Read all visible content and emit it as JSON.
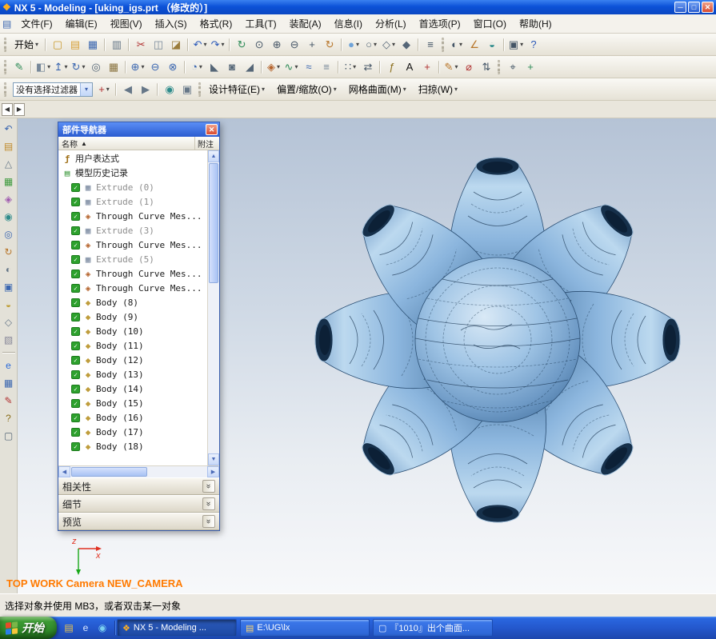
{
  "window": {
    "title": "NX 5 - Modeling - [uking_igs.prt （修改的）]"
  },
  "menubar": {
    "items": [
      "文件(F)",
      "编辑(E)",
      "视图(V)",
      "插入(S)",
      "格式(R)",
      "工具(T)",
      "装配(A)",
      "信息(I)",
      "分析(L)",
      "首选项(P)",
      "窗口(O)",
      "帮助(H)"
    ]
  },
  "toolbars": {
    "row1": [
      {
        "k": "grip"
      },
      {
        "k": "btn",
        "n": "start-app-menu-button",
        "g": "开始",
        "dd": true
      },
      {
        "k": "sep"
      },
      {
        "k": "icon",
        "n": "new-part-icon",
        "g": "▢",
        "c": "#c9992a"
      },
      {
        "k": "icon",
        "n": "open-icon",
        "g": "▤",
        "c": "#d8a23a"
      },
      {
        "k": "icon",
        "n": "save-icon",
        "g": "▦",
        "c": "#3a66b0"
      },
      {
        "k": "sep"
      },
      {
        "k": "icon",
        "n": "print-icon",
        "g": "▥",
        "c": "#667788"
      },
      {
        "k": "sep"
      },
      {
        "k": "icon",
        "n": "cut-icon",
        "g": "✂",
        "c": "#b03030"
      },
      {
        "k": "icon",
        "n": "copy-icon",
        "g": "◫",
        "c": "#778899"
      },
      {
        "k": "icon",
        "n": "paste-icon",
        "g": "◪",
        "c": "#9a7c3a"
      },
      {
        "k": "sep"
      },
      {
        "k": "icon",
        "n": "undo-icon",
        "g": "↶",
        "c": "#2a58b8",
        "dd": true
      },
      {
        "k": "icon",
        "n": "redo-icon",
        "g": "↷",
        "c": "#2a58b8",
        "dd": true
      },
      {
        "k": "sep"
      },
      {
        "k": "icon",
        "n": "refresh-icon",
        "g": "↻",
        "c": "#2e8b57"
      },
      {
        "k": "icon",
        "n": "fit-view-icon",
        "g": "⊙",
        "c": "#445566"
      },
      {
        "k": "icon",
        "n": "zoom-in-icon",
        "g": "⊕",
        "c": "#445566"
      },
      {
        "k": "icon",
        "n": "zoom-out-icon",
        "g": "⊖",
        "c": "#445566"
      },
      {
        "k": "icon",
        "n": "pan-icon",
        "g": "+",
        "c": "#445566"
      },
      {
        "k": "icon",
        "n": "rotate-view-icon",
        "g": "↻",
        "c": "#b8762a"
      },
      {
        "k": "sep"
      },
      {
        "k": "icon",
        "n": "shaded-view-icon",
        "g": "●",
        "c": "#6fa3d8",
        "dd": true
      },
      {
        "k": "icon",
        "n": "wireframe-view-icon",
        "g": "○",
        "c": "#556677",
        "dd": true
      },
      {
        "k": "icon",
        "n": "orient-view-icon",
        "g": "◇",
        "c": "#556677",
        "dd": true
      },
      {
        "k": "icon",
        "n": "perspective-icon",
        "g": "◆",
        "c": "#556677"
      },
      {
        "k": "sep"
      },
      {
        "k": "icon",
        "n": "layer-settings-icon",
        "g": "≡",
        "c": "#445566"
      },
      {
        "k": "grip"
      },
      {
        "k": "icon",
        "n": "show-hide-icon",
        "g": "◐",
        "c": "#445566",
        "dd": true
      },
      {
        "k": "icon",
        "n": "measure-icon",
        "g": "∠",
        "c": "#b8762a"
      },
      {
        "k": "icon",
        "n": "material-display-icon",
        "g": "◒",
        "c": "#2e8b8b"
      },
      {
        "k": "sep"
      },
      {
        "k": "icon",
        "n": "window-icon",
        "g": "▣",
        "c": "#445566",
        "dd": true
      },
      {
        "k": "icon",
        "n": "help-icon",
        "g": "?",
        "c": "#2a58b8"
      }
    ],
    "row2": [
      {
        "k": "grip"
      },
      {
        "k": "icon",
        "n": "sketch-icon",
        "g": "✎",
        "c": "#2e8b57"
      },
      {
        "k": "sep"
      },
      {
        "k": "icon",
        "n": "datum-plane-icon",
        "g": "◧",
        "c": "#778899",
        "dd": true
      },
      {
        "k": "icon",
        "n": "extrude-icon",
        "g": "↥",
        "c": "#3a66b0",
        "dd": true
      },
      {
        "k": "icon",
        "n": "revolve-icon",
        "g": "↻",
        "c": "#3a66b0",
        "dd": true
      },
      {
        "k": "icon",
        "n": "hole-icon",
        "g": "◎",
        "c": "#556677"
      },
      {
        "k": "icon",
        "n": "block-icon",
        "g": "▦",
        "c": "#8a7440"
      },
      {
        "k": "sep"
      },
      {
        "k": "icon",
        "n": "unite-icon",
        "g": "⊕",
        "c": "#3a66b0",
        "dd": true
      },
      {
        "k": "icon",
        "n": "subtract-icon",
        "g": "⊖",
        "c": "#3a66b0"
      },
      {
        "k": "icon",
        "n": "intersect-icon",
        "g": "⊗",
        "c": "#3a66b0"
      },
      {
        "k": "sep"
      },
      {
        "k": "icon",
        "n": "edge-blend-icon",
        "g": "◔",
        "c": "#3a66b0",
        "dd": true
      },
      {
        "k": "icon",
        "n": "chamfer-icon",
        "g": "◣",
        "c": "#556677"
      },
      {
        "k": "icon",
        "n": "shell-icon",
        "g": "◙",
        "c": "#556677"
      },
      {
        "k": "icon",
        "n": "draft-icon",
        "g": "◢",
        "c": "#556677"
      },
      {
        "k": "sep"
      },
      {
        "k": "icon",
        "n": "through-curve-mesh-icon",
        "g": "◈",
        "c": "#b4622a",
        "dd": true
      },
      {
        "k": "icon",
        "n": "swept-icon",
        "g": "∿",
        "c": "#2e8b57",
        "dd": true
      },
      {
        "k": "icon",
        "n": "ruled-surface-icon",
        "g": "≈",
        "c": "#3a66b0"
      },
      {
        "k": "icon",
        "n": "offset-surface-icon",
        "g": "≡",
        "c": "#778899"
      },
      {
        "k": "sep"
      },
      {
        "k": "icon",
        "n": "pattern-icon",
        "g": "∷",
        "c": "#445566",
        "dd": true
      },
      {
        "k": "icon",
        "n": "mirror-icon",
        "g": "⇄",
        "c": "#445566"
      },
      {
        "k": "sep"
      },
      {
        "k": "icon",
        "n": "expression-icon",
        "g": "ƒ",
        "c": "#8a6d1a"
      },
      {
        "k": "icon",
        "n": "text-icon",
        "g": "A",
        "c": "#111111"
      },
      {
        "k": "icon",
        "n": "point-icon",
        "g": "+",
        "c": "#b03030"
      },
      {
        "k": "sep"
      },
      {
        "k": "icon",
        "n": "edit-feature-icon",
        "g": "✎",
        "c": "#b8762a",
        "dd": true
      },
      {
        "k": "icon",
        "n": "suppress-feature-icon",
        "g": "⌀",
        "c": "#b03030"
      },
      {
        "k": "icon",
        "n": "move-object-icon",
        "g": "⇅",
        "c": "#445566"
      },
      {
        "k": "grip"
      },
      {
        "k": "icon",
        "n": "snap-point-icon",
        "g": "⌖",
        "c": "#445566"
      },
      {
        "k": "icon",
        "n": "wcs-icon",
        "g": "+",
        "c": "#2e8b57"
      }
    ],
    "filter_combo": "没有选择过滤器",
    "filter_icons": [
      {
        "k": "icon",
        "n": "general-selection-icon",
        "g": "+",
        "c": "#b03030",
        "dd": true
      },
      {
        "k": "sep"
      },
      {
        "k": "icon",
        "n": "previous-selection-icon",
        "g": "◀",
        "c": "#667788"
      },
      {
        "k": "icon",
        "n": "next-selection-icon",
        "g": "▶",
        "c": "#667788"
      },
      {
        "k": "sep"
      },
      {
        "k": "icon",
        "n": "snap-enable-icon",
        "g": "◉",
        "c": "#2e8b8b"
      },
      {
        "k": "icon",
        "n": "capture-icon",
        "g": "▣",
        "c": "#667788"
      },
      {
        "k": "grip"
      }
    ],
    "filter_menus": [
      {
        "n": "design-features-menu",
        "label": "设计特征(E)"
      },
      {
        "n": "offset-scale-menu",
        "label": "偏置/缩放(O)"
      },
      {
        "n": "mesh-surface-menu",
        "label": "网格曲面(M)"
      },
      {
        "n": "sweep-menu",
        "label": "扫掠(W)"
      }
    ]
  },
  "resource_bar": {
    "icons": [
      {
        "k": "icon",
        "n": "nav-back-icon",
        "g": "↶",
        "c": "#3a66b0"
      },
      {
        "k": "icon",
        "n": "assembly-navigator-icon",
        "g": "▤",
        "c": "#c08a2a"
      },
      {
        "k": "icon",
        "n": "constraint-navigator-icon",
        "g": "△",
        "c": "#667788"
      },
      {
        "k": "icon",
        "n": "part-navigator-icon",
        "g": "▦",
        "c": "#3e9a3e"
      },
      {
        "k": "icon",
        "n": "reuse-library-icon",
        "g": "◈",
        "c": "#a05bb0"
      },
      {
        "k": "icon",
        "n": "hd3d-tool-icon",
        "g": "◉",
        "c": "#2e8b8b"
      },
      {
        "k": "icon",
        "n": "web-browser-icon",
        "g": "◎",
        "c": "#3a66b0"
      },
      {
        "k": "icon",
        "n": "history-palette-icon",
        "g": "↻",
        "c": "#b8762a"
      },
      {
        "k": "icon",
        "n": "material-palette-icon",
        "g": "◐",
        "c": "#667788"
      },
      {
        "k": "icon",
        "n": "process-studio-icon",
        "g": "▣",
        "c": "#3a66b0"
      },
      {
        "k": "icon",
        "n": "roles-icon",
        "g": "◒",
        "c": "#c0a03a"
      },
      {
        "k": "icon",
        "n": "system-materials-icon",
        "g": "◇",
        "c": "#667788"
      },
      {
        "k": "icon",
        "n": "touch-mode-icon",
        "g": "▧",
        "c": "#889"
      },
      {
        "k": "sep"
      },
      {
        "k": "icon",
        "n": "internet-explorer-icon",
        "g": "e",
        "c": "#2a6ad8"
      },
      {
        "k": "icon",
        "n": "save-layout-icon",
        "g": "▦",
        "c": "#3a66b0"
      },
      {
        "k": "icon",
        "n": "annotate-icon",
        "g": "✎",
        "c": "#b03030"
      },
      {
        "k": "icon",
        "n": "help-icon",
        "g": "?",
        "c": "#8a6d1a"
      },
      {
        "k": "icon",
        "n": "document-icon",
        "g": "▢",
        "c": "#556677"
      }
    ]
  },
  "navigator": {
    "title": "部件导航器",
    "header": {
      "name": "名称",
      "sort": "▲",
      "note": "附注"
    },
    "tree": [
      {
        "label": "用户表达式",
        "type": "expressions",
        "ind": 0
      },
      {
        "label": "模型历史记录",
        "type": "history",
        "ind": 0
      },
      {
        "label": "Extrude (0)",
        "type": "extrude",
        "ind": 1,
        "check": true,
        "muted": true
      },
      {
        "label": "Extrude (1)",
        "type": "extrude",
        "ind": 1,
        "check": true,
        "muted": true
      },
      {
        "label": "Through Curve Mes...",
        "type": "mesh",
        "ind": 1,
        "check": true
      },
      {
        "label": "Extrude (3)",
        "type": "extrude",
        "ind": 1,
        "check": true,
        "muted": true
      },
      {
        "label": "Through Curve Mes...",
        "type": "mesh",
        "ind": 1,
        "check": true
      },
      {
        "label": "Extrude (5)",
        "type": "extrude",
        "ind": 1,
        "check": true,
        "muted": true
      },
      {
        "label": "Through Curve Mes...",
        "type": "mesh",
        "ind": 1,
        "check": true
      },
      {
        "label": "Through Curve Mes...",
        "type": "mesh",
        "ind": 1,
        "check": true
      },
      {
        "label": "Body (8)",
        "type": "body",
        "ind": 1,
        "check": true
      },
      {
        "label": "Body (9)",
        "type": "body",
        "ind": 1,
        "check": true
      },
      {
        "label": "Body (10)",
        "type": "body",
        "ind": 1,
        "check": true
      },
      {
        "label": "Body (11)",
        "type": "body",
        "ind": 1,
        "check": true
      },
      {
        "label": "Body (12)",
        "type": "body",
        "ind": 1,
        "check": true
      },
      {
        "label": "Body (13)",
        "type": "body",
        "ind": 1,
        "check": true
      },
      {
        "label": "Body (14)",
        "type": "body",
        "ind": 1,
        "check": true
      },
      {
        "label": "Body (15)",
        "type": "body",
        "ind": 1,
        "check": true
      },
      {
        "label": "Body (16)",
        "type": "body",
        "ind": 1,
        "check": true
      },
      {
        "label": "Body (17)",
        "type": "body",
        "ind": 1,
        "check": true
      },
      {
        "label": "Body (18)",
        "type": "body",
        "ind": 1,
        "check": true
      }
    ],
    "sections": [
      {
        "label": "相关性"
      },
      {
        "label": "细节"
      },
      {
        "label": "预览"
      }
    ]
  },
  "viewport": {
    "annotation": "TOP WORK Camera NEW_CAMERA",
    "axis_x": "x",
    "axis_z": "z"
  },
  "statusbar": {
    "text": "选择对象并使用 MB3，或者双击某一对象"
  },
  "taskbar": {
    "start_label": "开始",
    "quick": [
      {
        "n": "quick-launch-folder-icon",
        "g": "▤",
        "c": "#f0c84a"
      },
      {
        "n": "quick-launch-ie-icon",
        "g": "e",
        "c": "#dbe9ff"
      },
      {
        "n": "quick-launch-media-icon",
        "g": "◉",
        "c": "#7ad0f0"
      }
    ],
    "tasks": [
      {
        "label": "NX 5 - Modeling ...",
        "g": "❖",
        "c": "#ffb020",
        "active": true
      },
      {
        "label": "E:\\UG\\lx",
        "g": "▤",
        "c": "#ffd76e"
      },
      {
        "label": "『1010』出个曲面...",
        "g": "▢",
        "c": "#e8f0ff"
      }
    ]
  }
}
